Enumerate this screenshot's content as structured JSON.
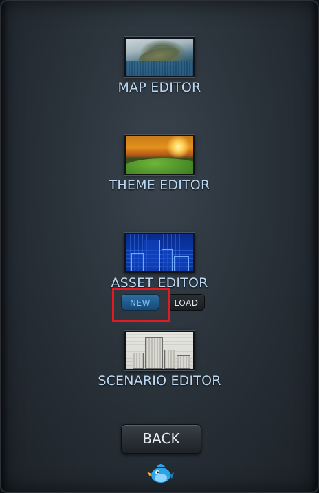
{
  "menu": {
    "editors": [
      {
        "label": "MAP EDITOR",
        "icon": "map-thumbnail"
      },
      {
        "label": "THEME EDITOR",
        "icon": "theme-thumbnail"
      },
      {
        "label": "ASSET EDITOR",
        "icon": "asset-thumbnail"
      },
      {
        "label": "SCENARIO EDITOR",
        "icon": "scenario-thumbnail"
      }
    ],
    "asset_actions": {
      "new_label": "NEW",
      "load_label": "LOAD"
    },
    "back_label": "BACK"
  },
  "colors": {
    "label_text": "#bcd8f2",
    "new_button": "#1f5a8c",
    "highlight": "#e11b24",
    "mascot": "#2aa3e8"
  }
}
